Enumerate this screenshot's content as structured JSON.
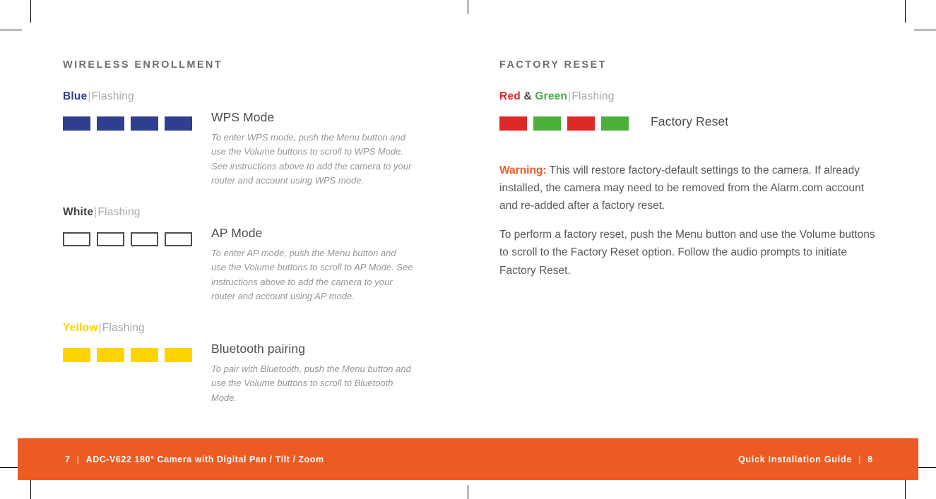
{
  "page": {
    "colors": {
      "brand_orange": "#ec5b23",
      "warning_orange": "#f15a22",
      "blue": "#2f3f8e",
      "yellow": "#ffd400",
      "red": "#dc2826",
      "green": "#4caf3a",
      "heading_gray": "#6d6e71",
      "body_gray": "#58595b",
      "muted_gray": "#939598"
    }
  },
  "left_column": {
    "heading": "WIRELESS ENROLLMENT",
    "groups": [
      {
        "color_name": "Blue",
        "separator": "|",
        "state": "Flashing",
        "swatch_style": "blue",
        "swatch_count": 4,
        "title": "WPS Mode",
        "description": "To enter WPS mode, push the Menu button and use the Volume buttons to scroll to WPS Mode. See instructions above to add the camera to your router and account using WPS mode."
      },
      {
        "color_name": "White",
        "separator": "|",
        "state": "Flashing",
        "swatch_style": "white",
        "swatch_count": 4,
        "title": "AP Mode",
        "description": "To enter AP mode, push the Menu button and use the Volume buttons to scroll to AP Mode. See instructions above to add the camera to your router and account using AP mode."
      },
      {
        "color_name": "Yellow",
        "separator": "|",
        "state": "Flashing",
        "swatch_style": "yellow",
        "swatch_count": 4,
        "title": "Bluetooth pairing",
        "description": "To pair with Bluetooth, push the Menu button and use the Volume buttons to scroll to Bluetooth Mode."
      }
    ]
  },
  "right_column": {
    "heading": "FACTORY RESET",
    "group": {
      "color_name_1": "Red",
      "ampersand": "&",
      "color_name_2": "Green",
      "separator": "|",
      "state": "Flashing",
      "swatch_sequence": [
        "red",
        "green",
        "red",
        "green"
      ],
      "title": "Factory Reset"
    },
    "warning_label": "Warning:",
    "warning_text": " This will restore factory-default settings to the camera. If already installed, the camera may need to be removed from the Alarm.com account and re-added after a factory reset.",
    "paragraph": "To perform a factory reset, push the Menu button and use the Volume buttons to scroll to the Factory Reset option. Follow the audio prompts to initiate Factory Reset."
  },
  "footer": {
    "left_page_number": "7",
    "left_divider": "|",
    "left_title": "ADC-V622 180° Camera with Digital Pan / Tilt / Zoom",
    "right_title": "Quick Installation Guide",
    "right_divider": "|",
    "right_page_number": "8"
  }
}
